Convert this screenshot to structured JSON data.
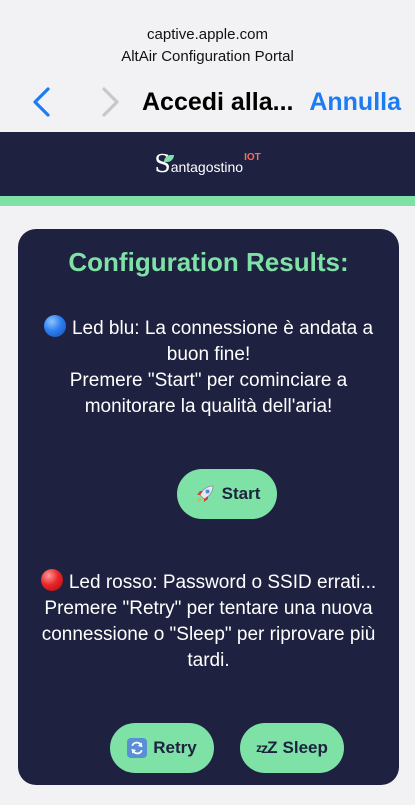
{
  "browser": {
    "host": "captive.apple.com",
    "portal_title": "AltAir Configuration Portal",
    "page_title": "Accedi alla...",
    "cancel_label": "Annulla"
  },
  "site": {
    "logo_s": "S",
    "logo_text": "antagostino",
    "logo_suffix": "IOT"
  },
  "card": {
    "title": "Configuration Results:",
    "blue_message": {
      "icon": "blue-circle-icon",
      "line1": "Led blu: La connessione è andata a buon fine!",
      "line2": "Premere \"Start\" per cominciare a monitorare la qualità dell'aria!"
    },
    "red_message": {
      "icon": "red-circle-icon",
      "line1": "Led rosso: Password o SSID errati...",
      "line2": "Premere \"Retry\" per tentare una nuova connessione o \"Sleep\" per riprovare più tardi."
    },
    "buttons": {
      "start_label": "Start",
      "start_icon": "rocket-icon",
      "retry_label": "Retry",
      "retry_icon": "refresh-icon",
      "sleep_label": "Sleep",
      "sleep_icon": "zzz-icon"
    }
  },
  "colors": {
    "header_bg": "#1e2240",
    "accent": "#7ee1a6",
    "link_blue": "#1d7cf2",
    "iot_red": "#ff6a5a"
  }
}
